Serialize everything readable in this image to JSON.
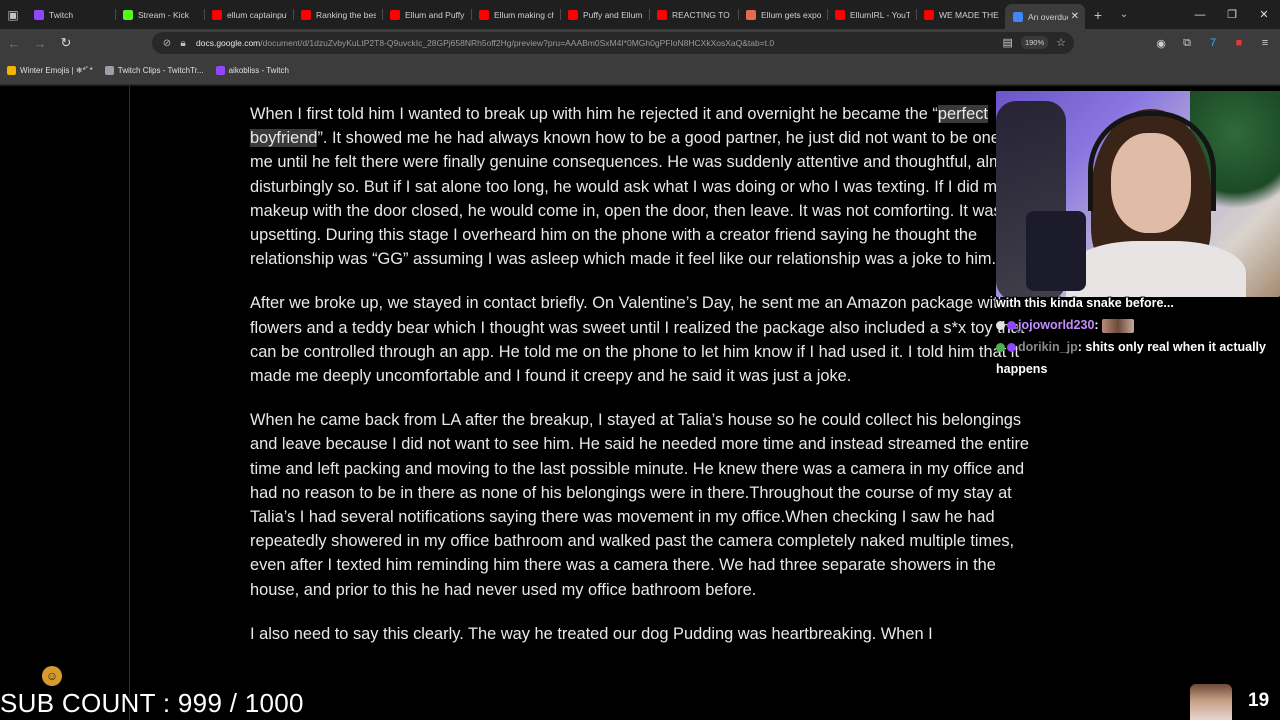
{
  "tabs": [
    {
      "title": "Twitch",
      "color": "#9146ff"
    },
    {
      "title": "Stream - Kick",
      "color": "#53fc18"
    },
    {
      "title": "ellum captainpuff",
      "color": "#ff0000"
    },
    {
      "title": "Ranking the best",
      "color": "#ff0000"
    },
    {
      "title": "Ellum and Puffy n",
      "color": "#ff0000"
    },
    {
      "title": "Ellum making che",
      "color": "#ff0000"
    },
    {
      "title": "Puffy and Ellum a",
      "color": "#ff0000"
    },
    {
      "title": "REACTING TO SIE",
      "color": "#ff0000"
    },
    {
      "title": "Ellum gets expos",
      "color": "#e36c4b"
    },
    {
      "title": "EllumIRL - YouTub",
      "color": "#ff0000"
    },
    {
      "title": "WE MADE THE W",
      "color": "#ff0000"
    }
  ],
  "active_tab": {
    "title": "An overdue ex",
    "color": "#4285f4"
  },
  "toolbar": {
    "url_host": "docs.google.com",
    "url_path": "/document/d/1dzuZvbyKuLtP2T8-Q9uvckIc_28GPj658NRh5off2Hg/preview?pru=AAABm0SxM4I*0MGh0gPFIoN8HCXkXosXaQ&tab=t.0",
    "zoom": "190%"
  },
  "bookmarks": [
    {
      "label": "Winter Emojis | ❄*ﾟ*",
      "color": "#f2b400"
    },
    {
      "label": "Twitch Clips - TwitchTr...",
      "color": "#9aa0a6"
    },
    {
      "label": "aikobliss - Twitch",
      "color": "#9146ff"
    }
  ],
  "doc": {
    "p1_before": "When I first told him I wanted to break up with him he rejected it and overnight he became the “",
    "p1_highlight": "perfect boyfriend",
    "p1_after": "”. It showed me he had always known how to be a good partner, he just did not want to be one for me until he felt there were finally genuine consequences. He was suddenly attentive and thoughtful, almost disturbingly so. But if I sat alone too long, he would ask what I was doing or who I was texting. If I did my makeup with the door closed, he would come in, open the door, then leave. It was not comforting. It was upsetting. During this stage I overheard him on the phone with a creator friend saying he thought the relationship was “GG” assuming I was asleep which made it feel like our relationship was a joke to him.",
    "p2": "After we broke up, we stayed in contact briefly. On Valentine’s Day, he sent me an Amazon package with flowers and a teddy bear which I thought was sweet until I realized the package also included a s*x toy that can be controlled through an app. He told me on the phone to let him know if I had used it. I told him that it made me deeply uncomfortable and I found it creepy and he said it was just a joke.",
    "p3": "When he came back from LA after the breakup, I stayed at Talia’s house so he could collect his belongings and leave because I did not want to see him. He said he needed more time and instead streamed the entire time and left packing and moving to the last possible minute. He knew there was a camera in my office and had no reason to be in there as none of his belongings were in there.Throughout the course of my stay at Talia’s I had several notifications saying there was movement in my office.When checking I saw he had repeatedly showered in my office bathroom and walked past the camera completely naked multiple times, even after I texted him reminding him there was a camera there. We had three separate showers in the house, and prior to this he had never used my office bathroom before.",
    "p4": "I also need to say this clearly. The way he treated our dog Pudding was heartbreaking. When I"
  },
  "chat": {
    "line0": "with this kinda snake before...",
    "msg1_user": "jojoworld230",
    "msg2_user": "dorikin_jp",
    "msg2_text": "shits only real when it actually happens"
  },
  "overlay": {
    "sub_count": "SUB COUNT : 999 / 1000",
    "viewer_count": "19"
  }
}
